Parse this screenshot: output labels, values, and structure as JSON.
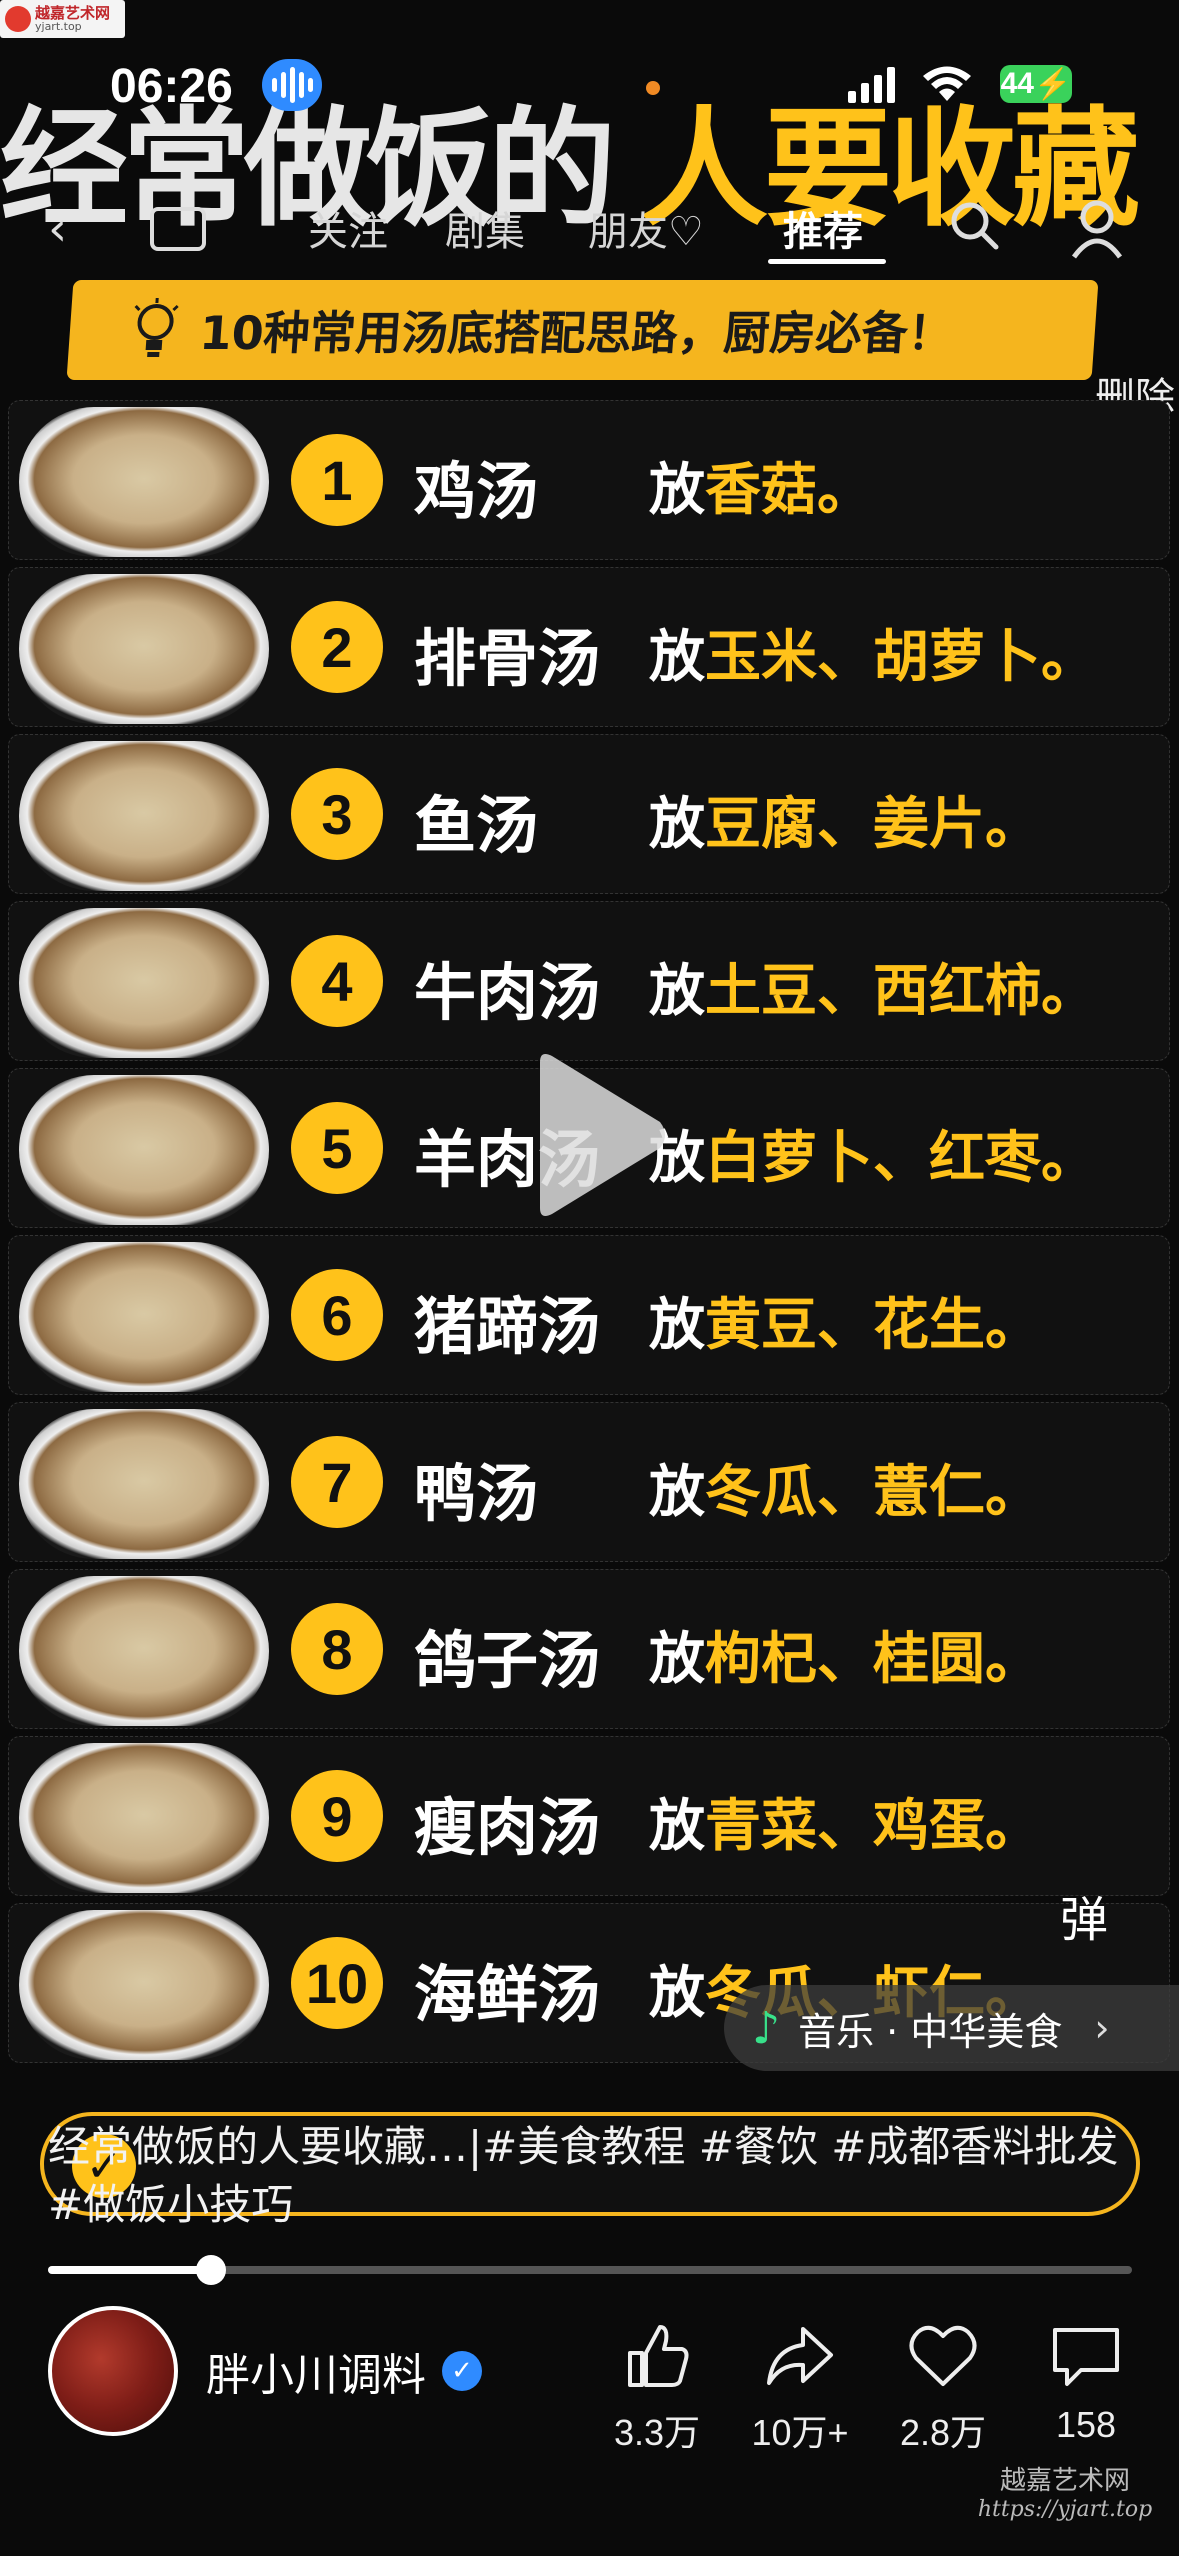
{
  "watermark_top": {
    "name": "越嘉艺术网",
    "url": "yjart.top"
  },
  "status": {
    "time": "06:26",
    "battery": "44"
  },
  "cover": {
    "title_white": "经常做饭的",
    "title_yellow": "人要收藏",
    "subtitle": "10种常用汤底搭配思路，厨房必备！"
  },
  "nav": {
    "tabs": [
      {
        "label": "关注"
      },
      {
        "label": "剧集"
      },
      {
        "label": "朋友♡"
      },
      {
        "label": "推荐"
      }
    ],
    "delete": "删除"
  },
  "soups": [
    {
      "num": "1",
      "name": "鸡汤",
      "fang": "放",
      "items": "香菇。"
    },
    {
      "num": "2",
      "name": "排骨汤",
      "fang": "放",
      "items": "玉米、胡萝卜。"
    },
    {
      "num": "3",
      "name": "鱼汤",
      "fang": "放",
      "items": "豆腐、姜片。"
    },
    {
      "num": "4",
      "name": "牛肉汤",
      "fang": "放",
      "items": "土豆、西红柿。"
    },
    {
      "num": "5",
      "name": "羊肉汤",
      "fang": "放",
      "items": "白萝卜、红枣。"
    },
    {
      "num": "6",
      "name": "猪蹄汤",
      "fang": "放",
      "items": "黄豆、花生。"
    },
    {
      "num": "7",
      "name": "鸭汤",
      "fang": "放",
      "items": "冬瓜、薏仁。"
    },
    {
      "num": "8",
      "name": "鸽子汤",
      "fang": "放",
      "items": "枸杞、桂圆。"
    },
    {
      "num": "9",
      "name": "瘦肉汤",
      "fang": "放",
      "items": "青菜、鸡蛋。"
    },
    {
      "num": "10",
      "name": "海鲜汤",
      "fang": "放",
      "items": "冬瓜、虾仁。"
    }
  ],
  "danmu": "弹",
  "music": {
    "label": "音乐 · 中华美食"
  },
  "video": {
    "description": "经常做饭的人要收藏…|#美食教程 #餐饮 #成都香料批发 #做饭小技巧",
    "progress": 0.15
  },
  "author": {
    "name": "胖小川调料"
  },
  "actions": {
    "likes": "3.3万",
    "shares": "10万+",
    "favorites": "2.8万",
    "comments": "158"
  },
  "watermark_bottom": {
    "name": "越嘉艺术网",
    "url": "https://yjart.top"
  },
  "colors": {
    "accent": "#ffc21a",
    "background": "#0a0a0a",
    "verify": "#2f8bff",
    "music_note": "#38e08a"
  }
}
